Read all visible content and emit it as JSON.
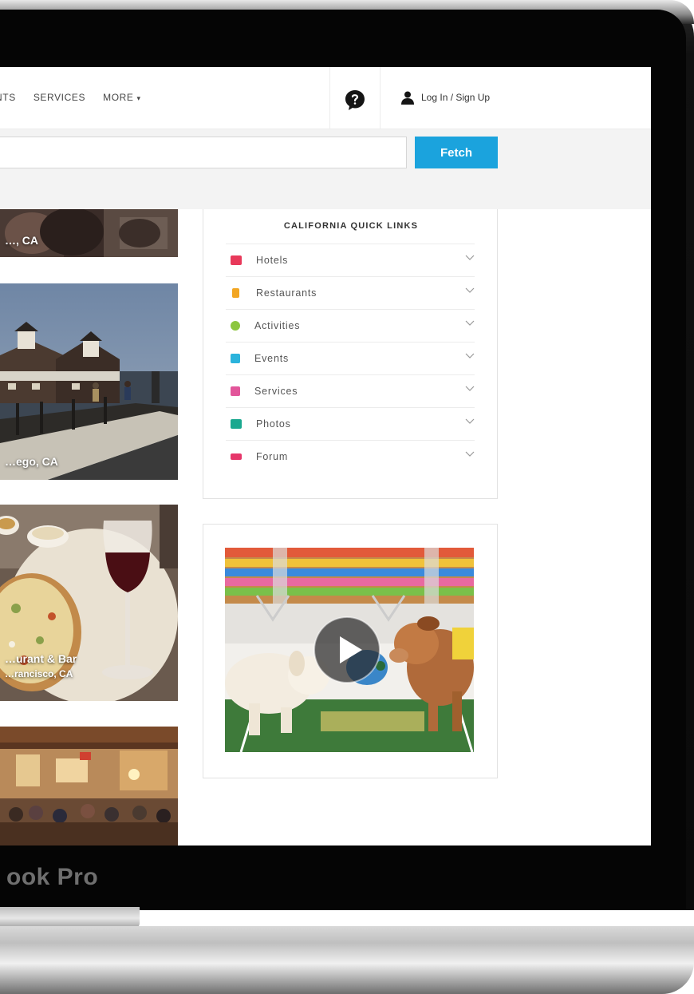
{
  "device": {
    "label": "ook Pro"
  },
  "nav": {
    "links": [
      "NTS",
      "SERVICES",
      "MORE"
    ],
    "more_caret": "▾",
    "login_label": "Log In / Sign Up"
  },
  "search": {
    "value": "",
    "placeholder": "",
    "button_label": "Fetch"
  },
  "cards": [
    {
      "caption": "…, CA"
    },
    {
      "caption": "…ego, CA"
    },
    {
      "caption_line1": "…urant & Bar",
      "caption_line2": "…rancisco, CA"
    },
    {
      "caption": ""
    }
  ],
  "quick_links": {
    "title": "CALIFORNIA QUICK LINKS",
    "items": [
      {
        "label": "Hotels",
        "icon": "hotel-bed-icon",
        "color": "#e8395a"
      },
      {
        "label": "Restaurants",
        "icon": "restaurant-icon",
        "color": "#f2a623"
      },
      {
        "label": "Activities",
        "icon": "activities-icon",
        "color": "#8cc63f"
      },
      {
        "label": "Events",
        "icon": "events-icon",
        "color": "#2bb3dc"
      },
      {
        "label": "Services",
        "icon": "services-bag-icon",
        "color": "#e2559a"
      },
      {
        "label": "Photos",
        "icon": "photos-camera-icon",
        "color": "#1aa88f"
      },
      {
        "label": "Forum",
        "icon": "forum-icon",
        "color": "#e6366a"
      }
    ]
  },
  "video": {
    "thumbnail": "puppy-bowl",
    "play_icon": "play-icon"
  },
  "colors": {
    "accent": "#1ba3dd"
  }
}
